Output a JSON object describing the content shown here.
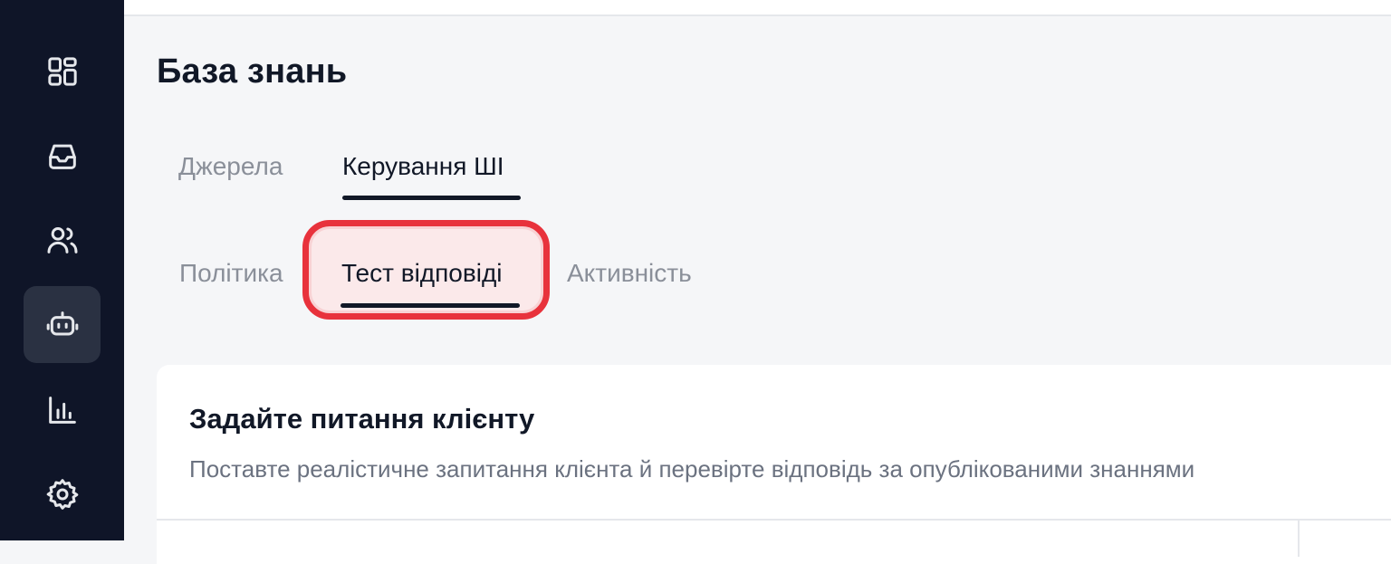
{
  "page": {
    "title": "База знань"
  },
  "sidebar": {
    "items": [
      {
        "icon": "dashboard-icon",
        "active": false
      },
      {
        "icon": "inbox-icon",
        "active": false
      },
      {
        "icon": "users-icon",
        "active": false
      },
      {
        "icon": "bot-icon",
        "active": true
      },
      {
        "icon": "analytics-icon",
        "active": false
      },
      {
        "icon": "gear-icon",
        "active": false
      }
    ]
  },
  "tabs": {
    "primary": [
      {
        "label": "Джерела",
        "active": false
      },
      {
        "label": "Керування ШІ",
        "active": true
      }
    ],
    "secondary": [
      {
        "label": "Політика",
        "active": false
      },
      {
        "label": "Тест відповіді",
        "active": true
      },
      {
        "label": "Активність",
        "active": false
      }
    ]
  },
  "card": {
    "title": "Задайте питання клієнту",
    "subtitle": "Поставте реалістичне запитання клієнта й перевірте відповідь за опублікованими знаннями"
  },
  "colors": {
    "sidebar_bg": "#0f1528",
    "page_bg": "#f5f6f8",
    "highlight": "#e8323c",
    "text_primary": "#111827",
    "text_muted": "#8a8f99"
  }
}
